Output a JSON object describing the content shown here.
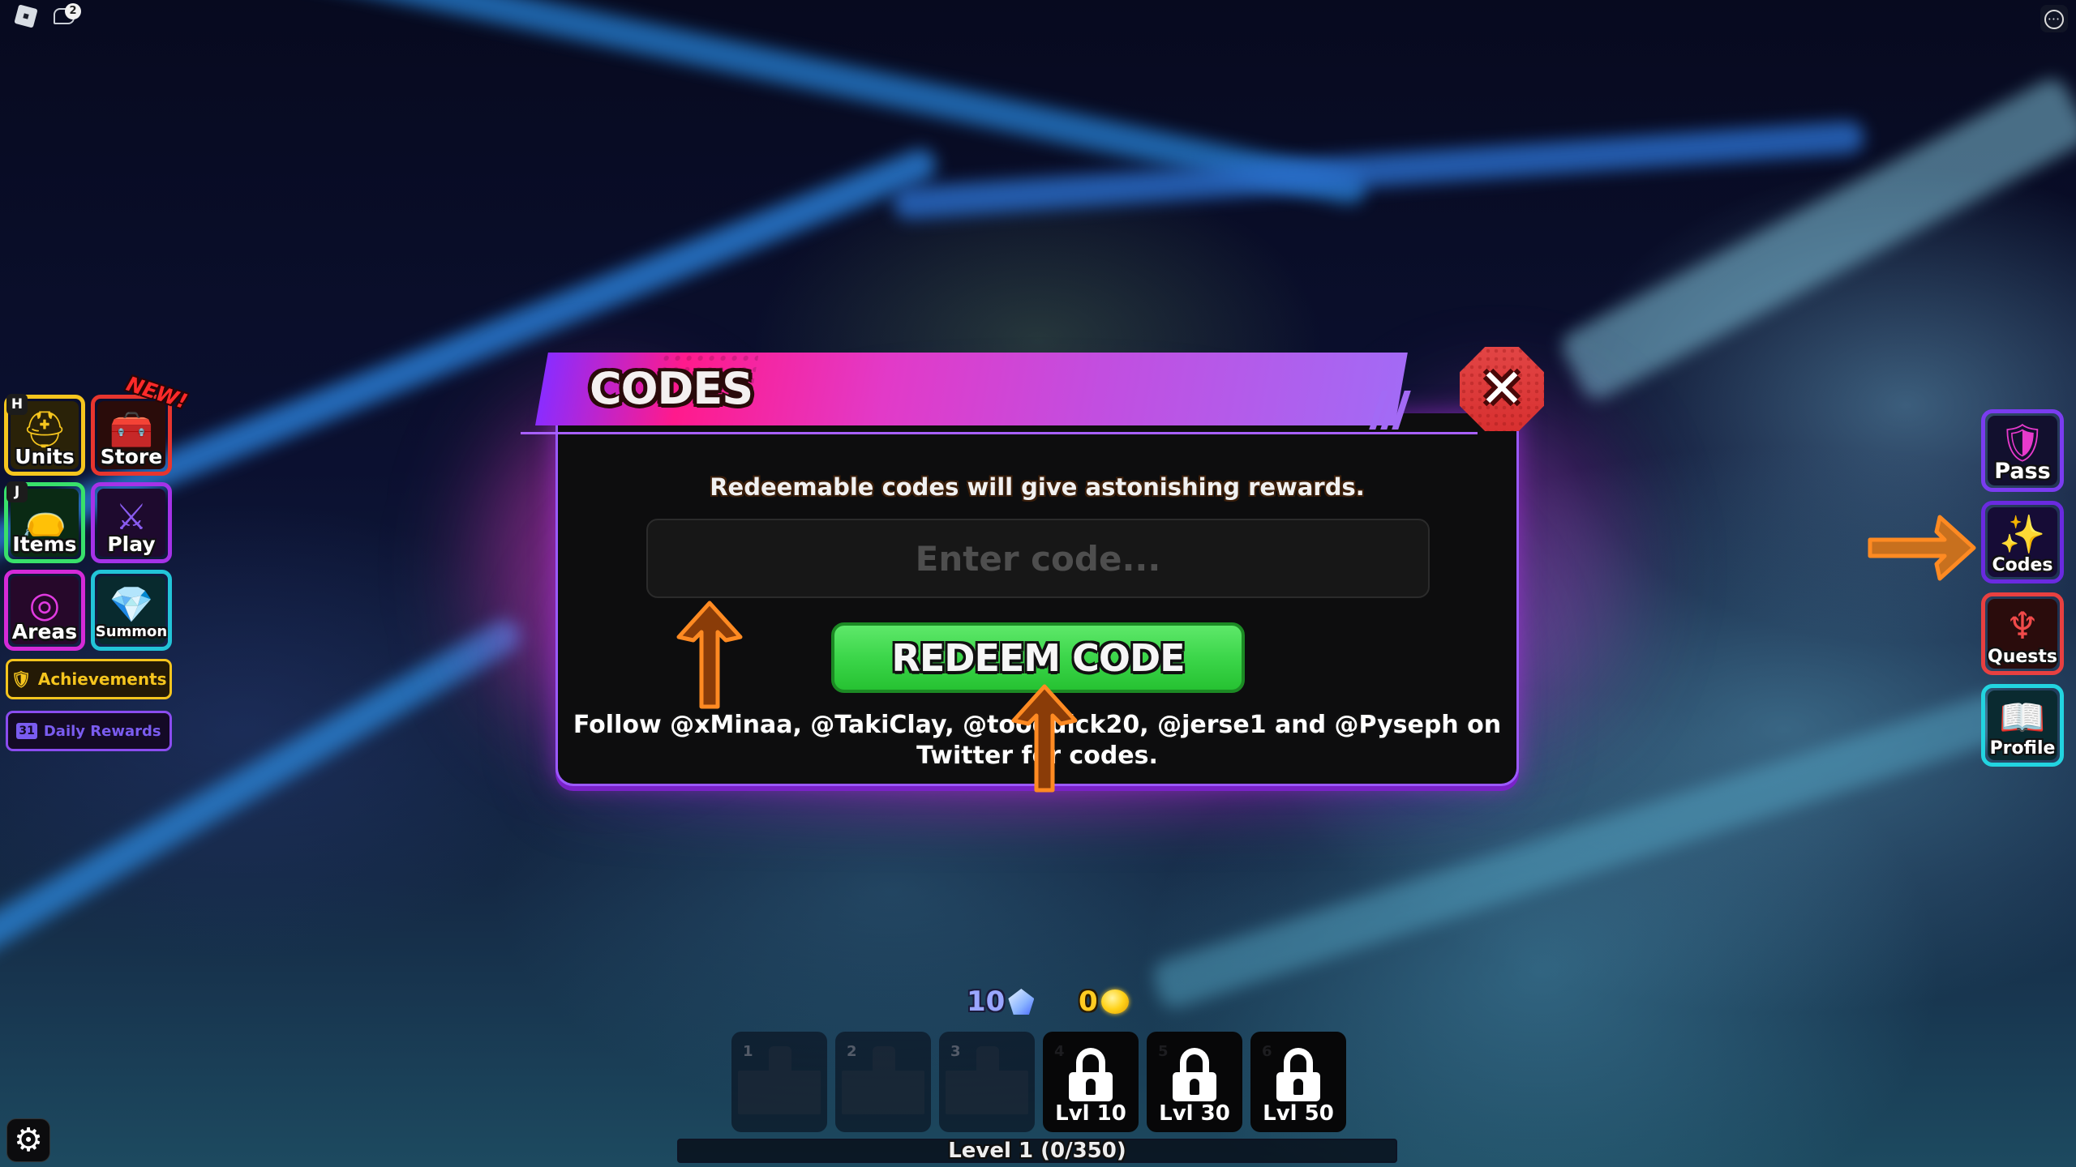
{
  "topbar": {
    "roblox_icon": "roblox-logo-icon",
    "chat_icon": "chat-icon",
    "chat_badge_count": "2",
    "menu_icon": "more-options-icon"
  },
  "left_menu": {
    "buttons": [
      {
        "label": "Units",
        "hotkey": "H",
        "icon": "helmet-icon",
        "glyph": "⛑",
        "border": "#f5c51e"
      },
      {
        "label": "Store",
        "hotkey": "",
        "icon": "treasure-chest-icon",
        "glyph": "🧰",
        "border": "#e8352e",
        "badge": "NEW!"
      },
      {
        "label": "Items",
        "hotkey": "J",
        "icon": "bag-icon",
        "glyph": "👝",
        "border": "#38e06b"
      },
      {
        "label": "Play",
        "hotkey": "",
        "icon": "sword-icon",
        "glyph": "⚔",
        "border": "#a532e8"
      },
      {
        "label": "Areas",
        "hotkey": "",
        "icon": "target-icon",
        "glyph": "◎",
        "border": "#d42ad8"
      },
      {
        "label": "Summon",
        "hotkey": "",
        "icon": "diamond-icon",
        "glyph": "💎",
        "border": "#22c4d8"
      }
    ],
    "achievements": {
      "label": "Achievements",
      "icon": "winged-shield-icon",
      "glyph": "🛡",
      "color": "#f5c51e"
    },
    "daily_rewards": {
      "label": "Daily Rewards",
      "icon": "calendar-icon",
      "glyph": "31",
      "color": "#7a5cf0"
    }
  },
  "right_menu": {
    "buttons": [
      {
        "label": "Pass",
        "icon": "winged-shield-icon",
        "glyph": "🛡",
        "border": "#7a3cf0"
      },
      {
        "label": "Codes",
        "icon": "stars-burst-icon",
        "glyph": "✨",
        "border": "#6a2ae0"
      },
      {
        "label": "Quests",
        "icon": "quest-flame-icon",
        "glyph": "♆",
        "border": "#e84040"
      },
      {
        "label": "Profile",
        "icon": "book-icon",
        "glyph": "📖",
        "border": "#22d4e0"
      }
    ]
  },
  "codes_panel": {
    "title": "CODES",
    "close_icon": "close-x-icon",
    "subtitle": "Redeemable codes will give astonishing rewards.",
    "input_value": "",
    "input_placeholder": "Enter code...",
    "redeem_label": "REDEEM CODE",
    "follow_text": "Follow @xMinaa, @TakiClay, @tooquick20, @jerse1 and @Pyseph on Twitter for codes.",
    "accent_color": "#a860ff",
    "button_color": "#3cd64a"
  },
  "annotations": {
    "arrow_icon": "orange-pointer-arrow-icon",
    "color": "#d86a12"
  },
  "currency": {
    "gems": "10",
    "gem_icon": "gem-icon",
    "coins": "0",
    "coin_icon": "coin-icon"
  },
  "hotbar": {
    "slots": [
      {
        "number": "1",
        "locked": false,
        "unlock_label": ""
      },
      {
        "number": "2",
        "locked": false,
        "unlock_label": ""
      },
      {
        "number": "3",
        "locked": false,
        "unlock_label": ""
      },
      {
        "number": "4",
        "locked": true,
        "unlock_label": "Lvl 10"
      },
      {
        "number": "5",
        "locked": true,
        "unlock_label": "Lvl 30"
      },
      {
        "number": "6",
        "locked": true,
        "unlock_label": "Lvl 50"
      }
    ],
    "level_text": "Level 1 (0/350)",
    "level_progress": 0
  },
  "settings": {
    "icon": "gear-icon",
    "glyph": "⚙"
  }
}
